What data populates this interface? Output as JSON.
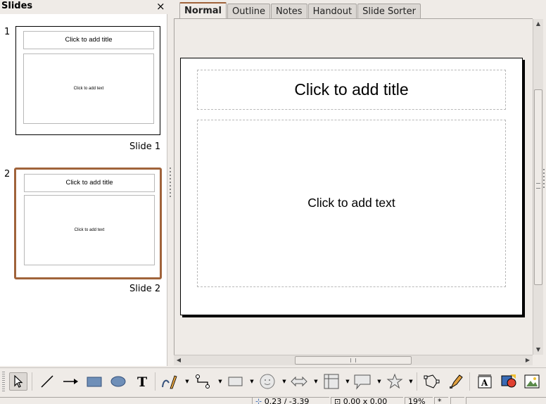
{
  "slides_pane": {
    "title": "Slides",
    "close_glyph": "×",
    "slides": [
      {
        "number": "1",
        "title": "Click to add title",
        "body": "Click to add text",
        "label": "Slide 1",
        "selected": false
      },
      {
        "number": "2",
        "title": "Click to add title",
        "body": "Click to add text",
        "label": "Slide 2",
        "selected": true
      }
    ]
  },
  "tabs": [
    {
      "label": "Normal",
      "active": true
    },
    {
      "label": "Outline",
      "active": false
    },
    {
      "label": "Notes",
      "active": false
    },
    {
      "label": "Handout",
      "active": false
    },
    {
      "label": "Slide Sorter",
      "active": false
    }
  ],
  "slide": {
    "title_placeholder": "Click to add title",
    "body_placeholder": "Click to add text"
  },
  "toolbar": {
    "tools": [
      "select-icon",
      "line-icon",
      "arrow-line-icon",
      "rectangle-icon",
      "ellipse-icon",
      "text-icon",
      "curve-icon",
      "connector-icon",
      "basic-shapes-icon",
      "symbol-shapes-icon",
      "block-arrows-icon",
      "flowchart-icon",
      "callouts-icon",
      "stars-icon",
      "points-icon",
      "glue-points-icon",
      "fontwork-icon",
      "from-file-icon",
      "image-icon"
    ]
  },
  "statusbar": {
    "position": "0.23 / -3.39",
    "size": "0.00 x 0.00",
    "zoom": "19%",
    "modified": "*"
  },
  "colors": {
    "selection_accent": "#a0633a",
    "chrome_bg": "#efebe7"
  }
}
